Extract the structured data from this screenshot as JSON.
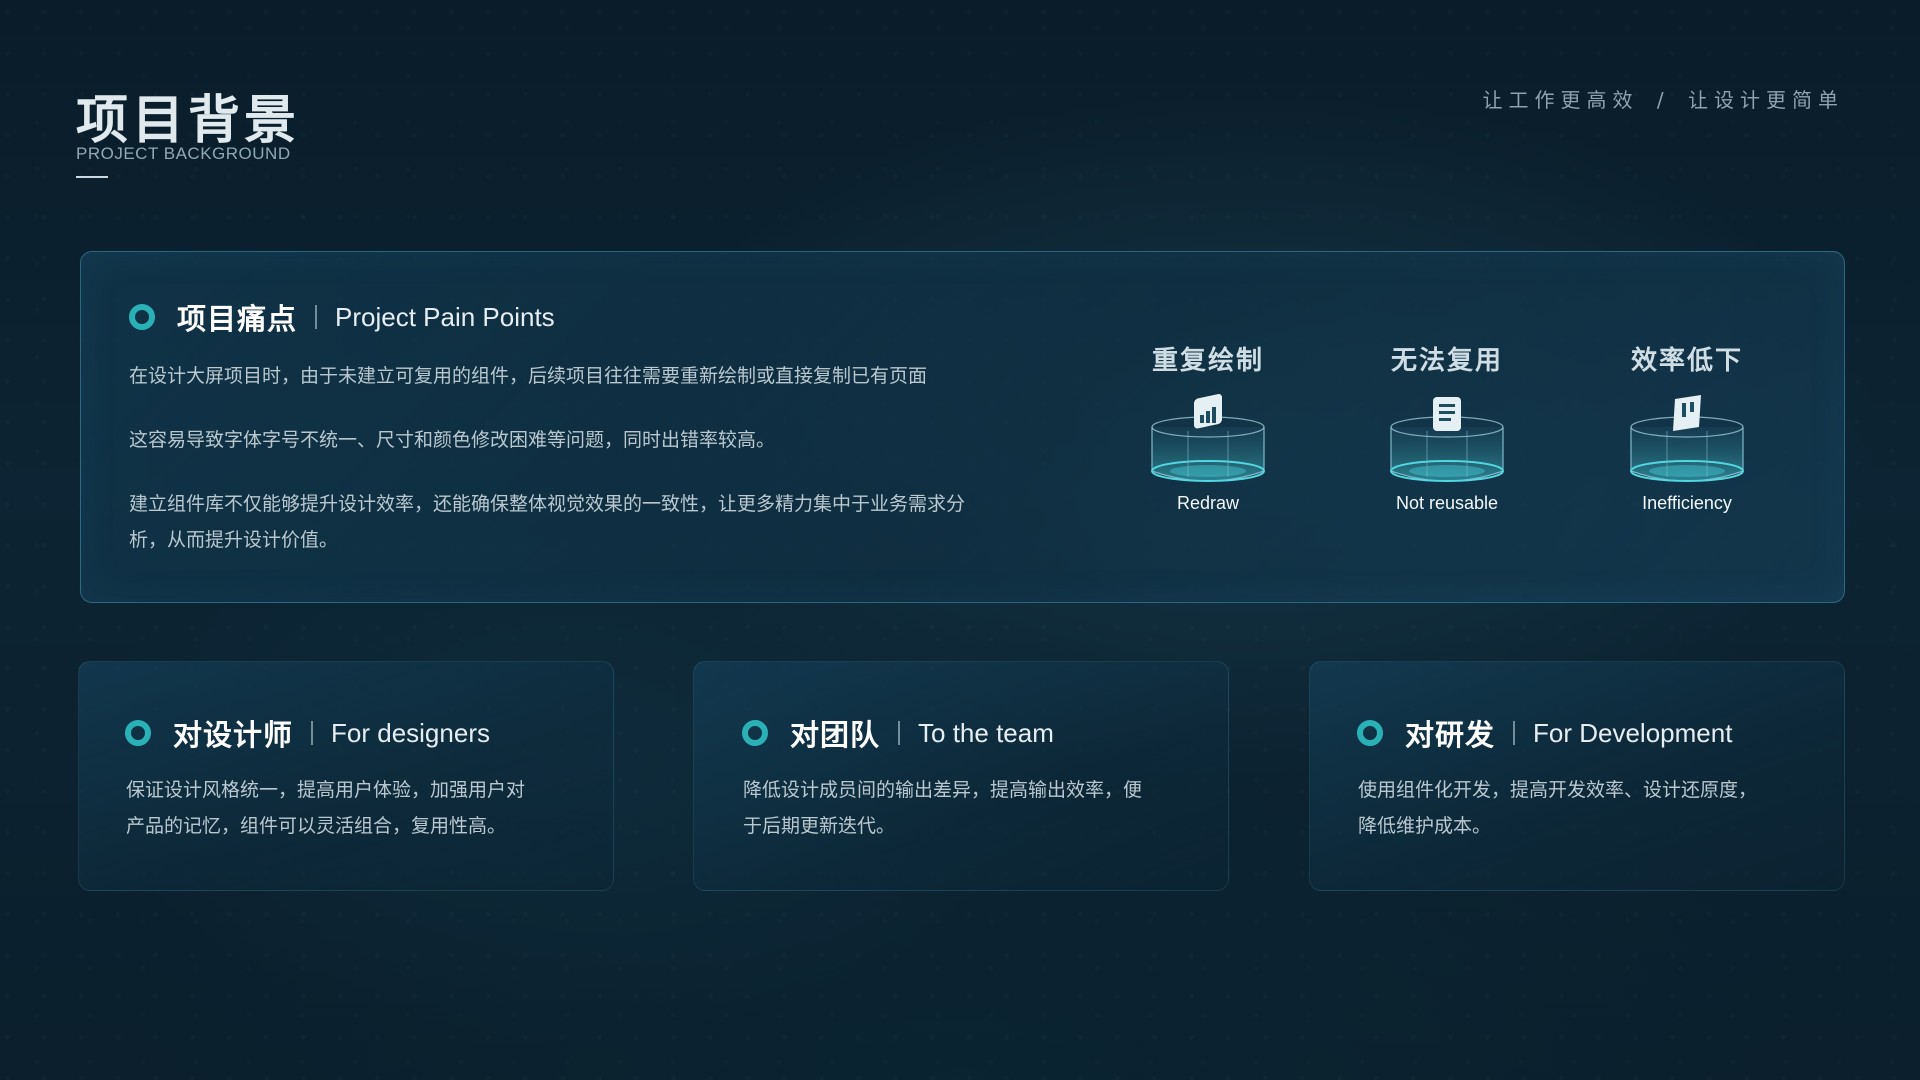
{
  "header": {
    "title": "项目背景",
    "subtitle": "PROJECT BACKGROUND",
    "tagline_left": "让工作更高效",
    "tagline_sep": "/",
    "tagline_right": "让设计更简单"
  },
  "main_card": {
    "title_cn": "项目痛点",
    "title_en": "Project Pain Points",
    "paragraphs": [
      "在设计大屏项目时，由于未建立可复用的组件，后续项目往往需要重新绘制或直接复制已有页面",
      "这容易导致字体字号不统一、尺寸和颜色修改困难等问题，同时出错率较高。",
      "建立组件库不仅能够提升设计效率，还能确保整体视觉效果的一致性，让更多精力集中于业务需求分",
      "析，从而提升设计价值。"
    ],
    "pain_points": [
      {
        "label_cn": "重复绘制",
        "label_en": "Redraw",
        "icon": "bar-chart-icon"
      },
      {
        "label_cn": "无法复用",
        "label_en": "Not reusable",
        "icon": "document-icon"
      },
      {
        "label_cn": "效率低下",
        "label_en": "Inefficiency",
        "icon": "bookmark-icon"
      }
    ]
  },
  "cards": [
    {
      "title_cn": "对设计师",
      "title_en": "For designers",
      "lines": [
        "保证设计风格统一，提高用户体验，加强用户对",
        "产品的记忆，组件可以灵活组合，复用性高。"
      ]
    },
    {
      "title_cn": "对团队",
      "title_en": "To the team",
      "lines": [
        "降低设计成员间的输出差异，提高输出效率，便",
        "于后期更新迭代。"
      ]
    },
    {
      "title_cn": "对研发",
      "title_en": "For Development",
      "lines": [
        "使用组件化开发，提高开发效率、设计还原度，",
        "降低维护成本。"
      ]
    }
  ],
  "colors": {
    "accent": "#2ab1b6",
    "background": "#0b2230",
    "card_border": "#3c9ec0"
  }
}
